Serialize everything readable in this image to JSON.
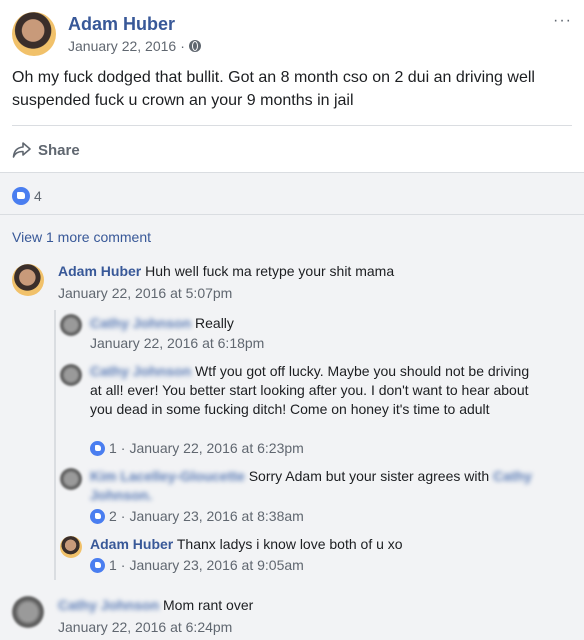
{
  "post": {
    "author": "Adam Huber",
    "date": "January 22, 2016",
    "meta_sep": "·",
    "more": "···",
    "text": "Oh my fuck dodged that bullit. Got an 8 month cso on 2 dui an driving well suspended fuck u crown an your 9 months in jail",
    "share_label": "Share",
    "like_count": "4"
  },
  "comments_section": {
    "view_more": "View 1 more comment"
  },
  "comments": [
    {
      "author": "Adam Huber",
      "text": "Huh well fuck ma retype your shit mama",
      "time": "January 22, 2016 at 5:07pm"
    },
    {
      "author": "Cathy Johnson",
      "text": "Really",
      "time": "January 22, 2016 at 6:18pm"
    },
    {
      "author": "Cathy Johnson",
      "text": "Wtf you got off lucky. Maybe you should not be driving at all! ever! You better start looking after you. I don't want to hear about you dead in some fucking ditch! Come on honey it's time to adult",
      "likes": "1",
      "time": "January 22, 2016 at 6:23pm"
    },
    {
      "author": "Kim Lacelley-Gloucette",
      "text": "Sorry Adam but your sister agrees with",
      "mention": "Cathy Johnson.",
      "likes": "2",
      "time": "January 23, 2016 at 8:38am"
    },
    {
      "author": "Adam Huber",
      "text": "Thanx ladys i know love both of u xo",
      "likes": "1",
      "time": "January 23, 2016 at 9:05am"
    },
    {
      "author": "Cathy Johnson",
      "text": "Mom rant over",
      "time": "January 22, 2016 at 6:24pm"
    }
  ],
  "colors": {
    "link": "#385898",
    "meta": "#606770",
    "like": "#4a7ef0",
    "comment_bg": "#f2f3f5"
  }
}
